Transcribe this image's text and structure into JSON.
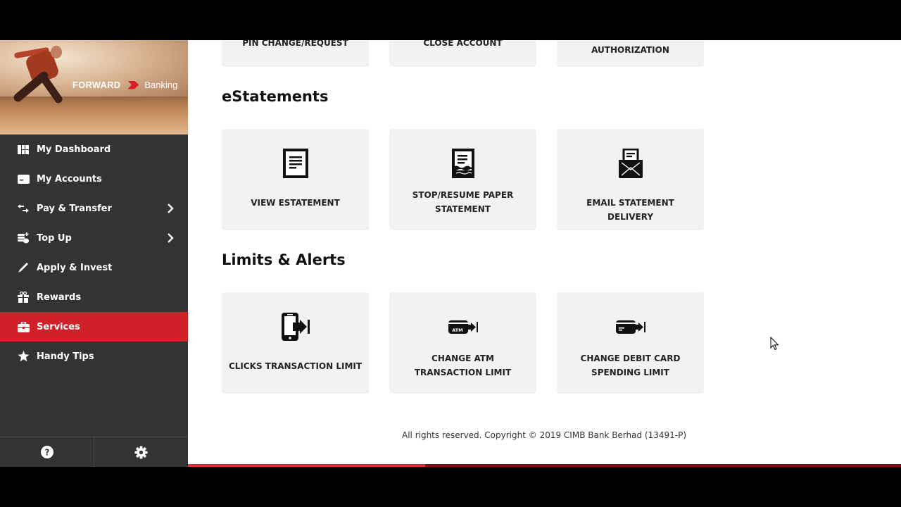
{
  "brand": {
    "name_primary": "FORWARD",
    "name_secondary": "Banking",
    "accent_color": "#d0202a"
  },
  "sidebar": {
    "items": [
      {
        "label": "My Dashboard",
        "icon": "dashboard-grid-icon",
        "has_submenu": false,
        "active": false
      },
      {
        "label": "My Accounts",
        "icon": "account-card-icon",
        "has_submenu": false,
        "active": false
      },
      {
        "label": "Pay & Transfer",
        "icon": "transfer-arrows-icon",
        "has_submenu": true,
        "active": false
      },
      {
        "label": "Top Up",
        "icon": "coins-plus-icon",
        "has_submenu": true,
        "active": false
      },
      {
        "label": "Apply & Invest",
        "icon": "pen-icon",
        "has_submenu": false,
        "active": false
      },
      {
        "label": "Rewards",
        "icon": "gift-icon",
        "has_submenu": false,
        "active": false
      },
      {
        "label": "Services",
        "icon": "briefcase-icon",
        "has_submenu": false,
        "active": true
      },
      {
        "label": "Handy Tips",
        "icon": "star-icon",
        "has_submenu": false,
        "active": false
      }
    ],
    "footer": {
      "help_icon": "help-circle-icon",
      "settings_icon": "gear-icon"
    }
  },
  "main": {
    "top_row_cards": [
      {
        "label": "PIN CHANGE/REQUEST"
      },
      {
        "label": "CLOSE ACCOUNT"
      },
      {
        "label": "AUTHORIZATION"
      }
    ],
    "sections": [
      {
        "title": "eStatements",
        "cards": [
          {
            "label": "VIEW ESTATEMENT",
            "icon": "document-icon"
          },
          {
            "label": "STOP/RESUME PAPER STATEMENT",
            "icon": "torn-document-icon"
          },
          {
            "label": "EMAIL STATEMENT DELIVERY",
            "icon": "envelope-letter-icon"
          }
        ]
      },
      {
        "title": "Limits & Alerts",
        "cards": [
          {
            "label": "CLICKS TRANSACTION LIMIT",
            "icon": "phone-arrow-icon"
          },
          {
            "label": "CHANGE ATM TRANSACTION LIMIT",
            "icon": "atm-card-arrow-icon",
            "icon_text": "ATM"
          },
          {
            "label": "CHANGE DEBIT CARD SPENDING LIMIT",
            "icon": "debit-card-arrow-icon"
          }
        ]
      }
    ],
    "footer": "All rights reserved. Copyright © 2019 CIMB Bank Berhad (13491-P)"
  },
  "video_progress": {
    "played_fraction": 0.333
  }
}
